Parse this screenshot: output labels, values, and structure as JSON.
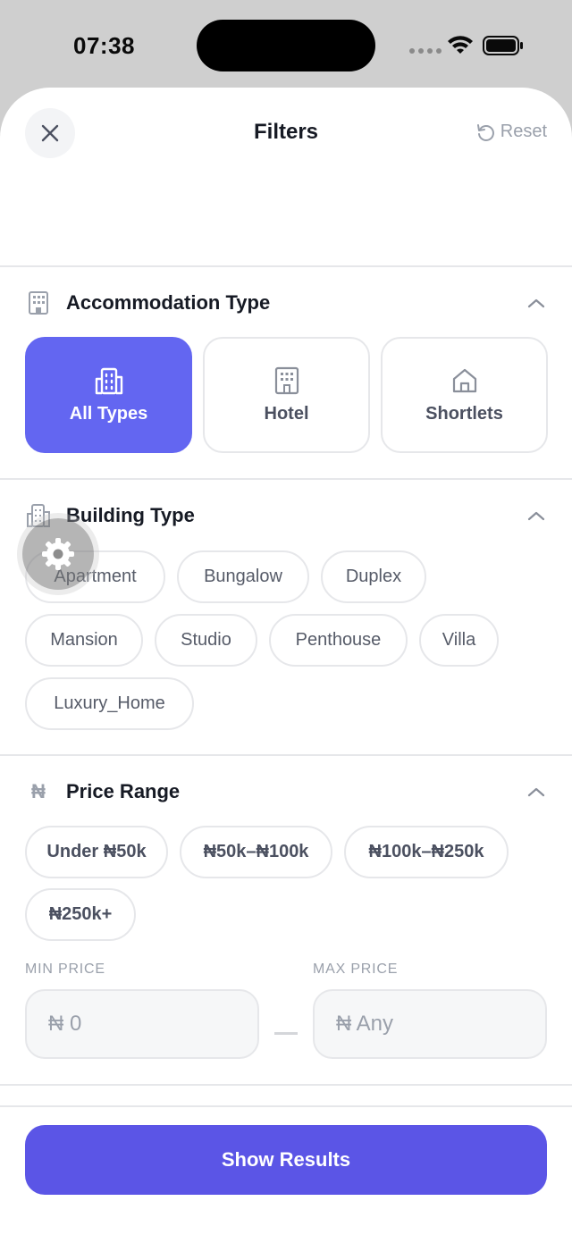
{
  "status": {
    "time": "07:38"
  },
  "header": {
    "title": "Filters",
    "reset_label": "Reset"
  },
  "accommodation": {
    "title": "Accommodation Type",
    "options": [
      {
        "label": "All Types",
        "icon": "buildings-icon",
        "selected": true
      },
      {
        "label": "Hotel",
        "icon": "hotel-icon",
        "selected": false
      },
      {
        "label": "Shortlets",
        "icon": "home-icon",
        "selected": false
      }
    ]
  },
  "building": {
    "title": "Building Type",
    "options": [
      "Apartment",
      "Bungalow",
      "Duplex",
      "Mansion",
      "Studio",
      "Penthouse",
      "Villa",
      "Luxury_Home"
    ]
  },
  "price": {
    "title": "Price Range",
    "icon_symbol": "₦",
    "presets": [
      "Under ₦50k",
      "₦50k–₦100k",
      "₦100k–₦250k",
      "₦250k+"
    ],
    "min_label": "MIN PRICE",
    "max_label": "MAX PRICE",
    "min_placeholder": "₦ 0",
    "max_placeholder": "₦ Any"
  },
  "footer": {
    "show_results_label": "Show Results"
  },
  "colors": {
    "accent": "#6366f1",
    "button": "#5b55e6"
  }
}
